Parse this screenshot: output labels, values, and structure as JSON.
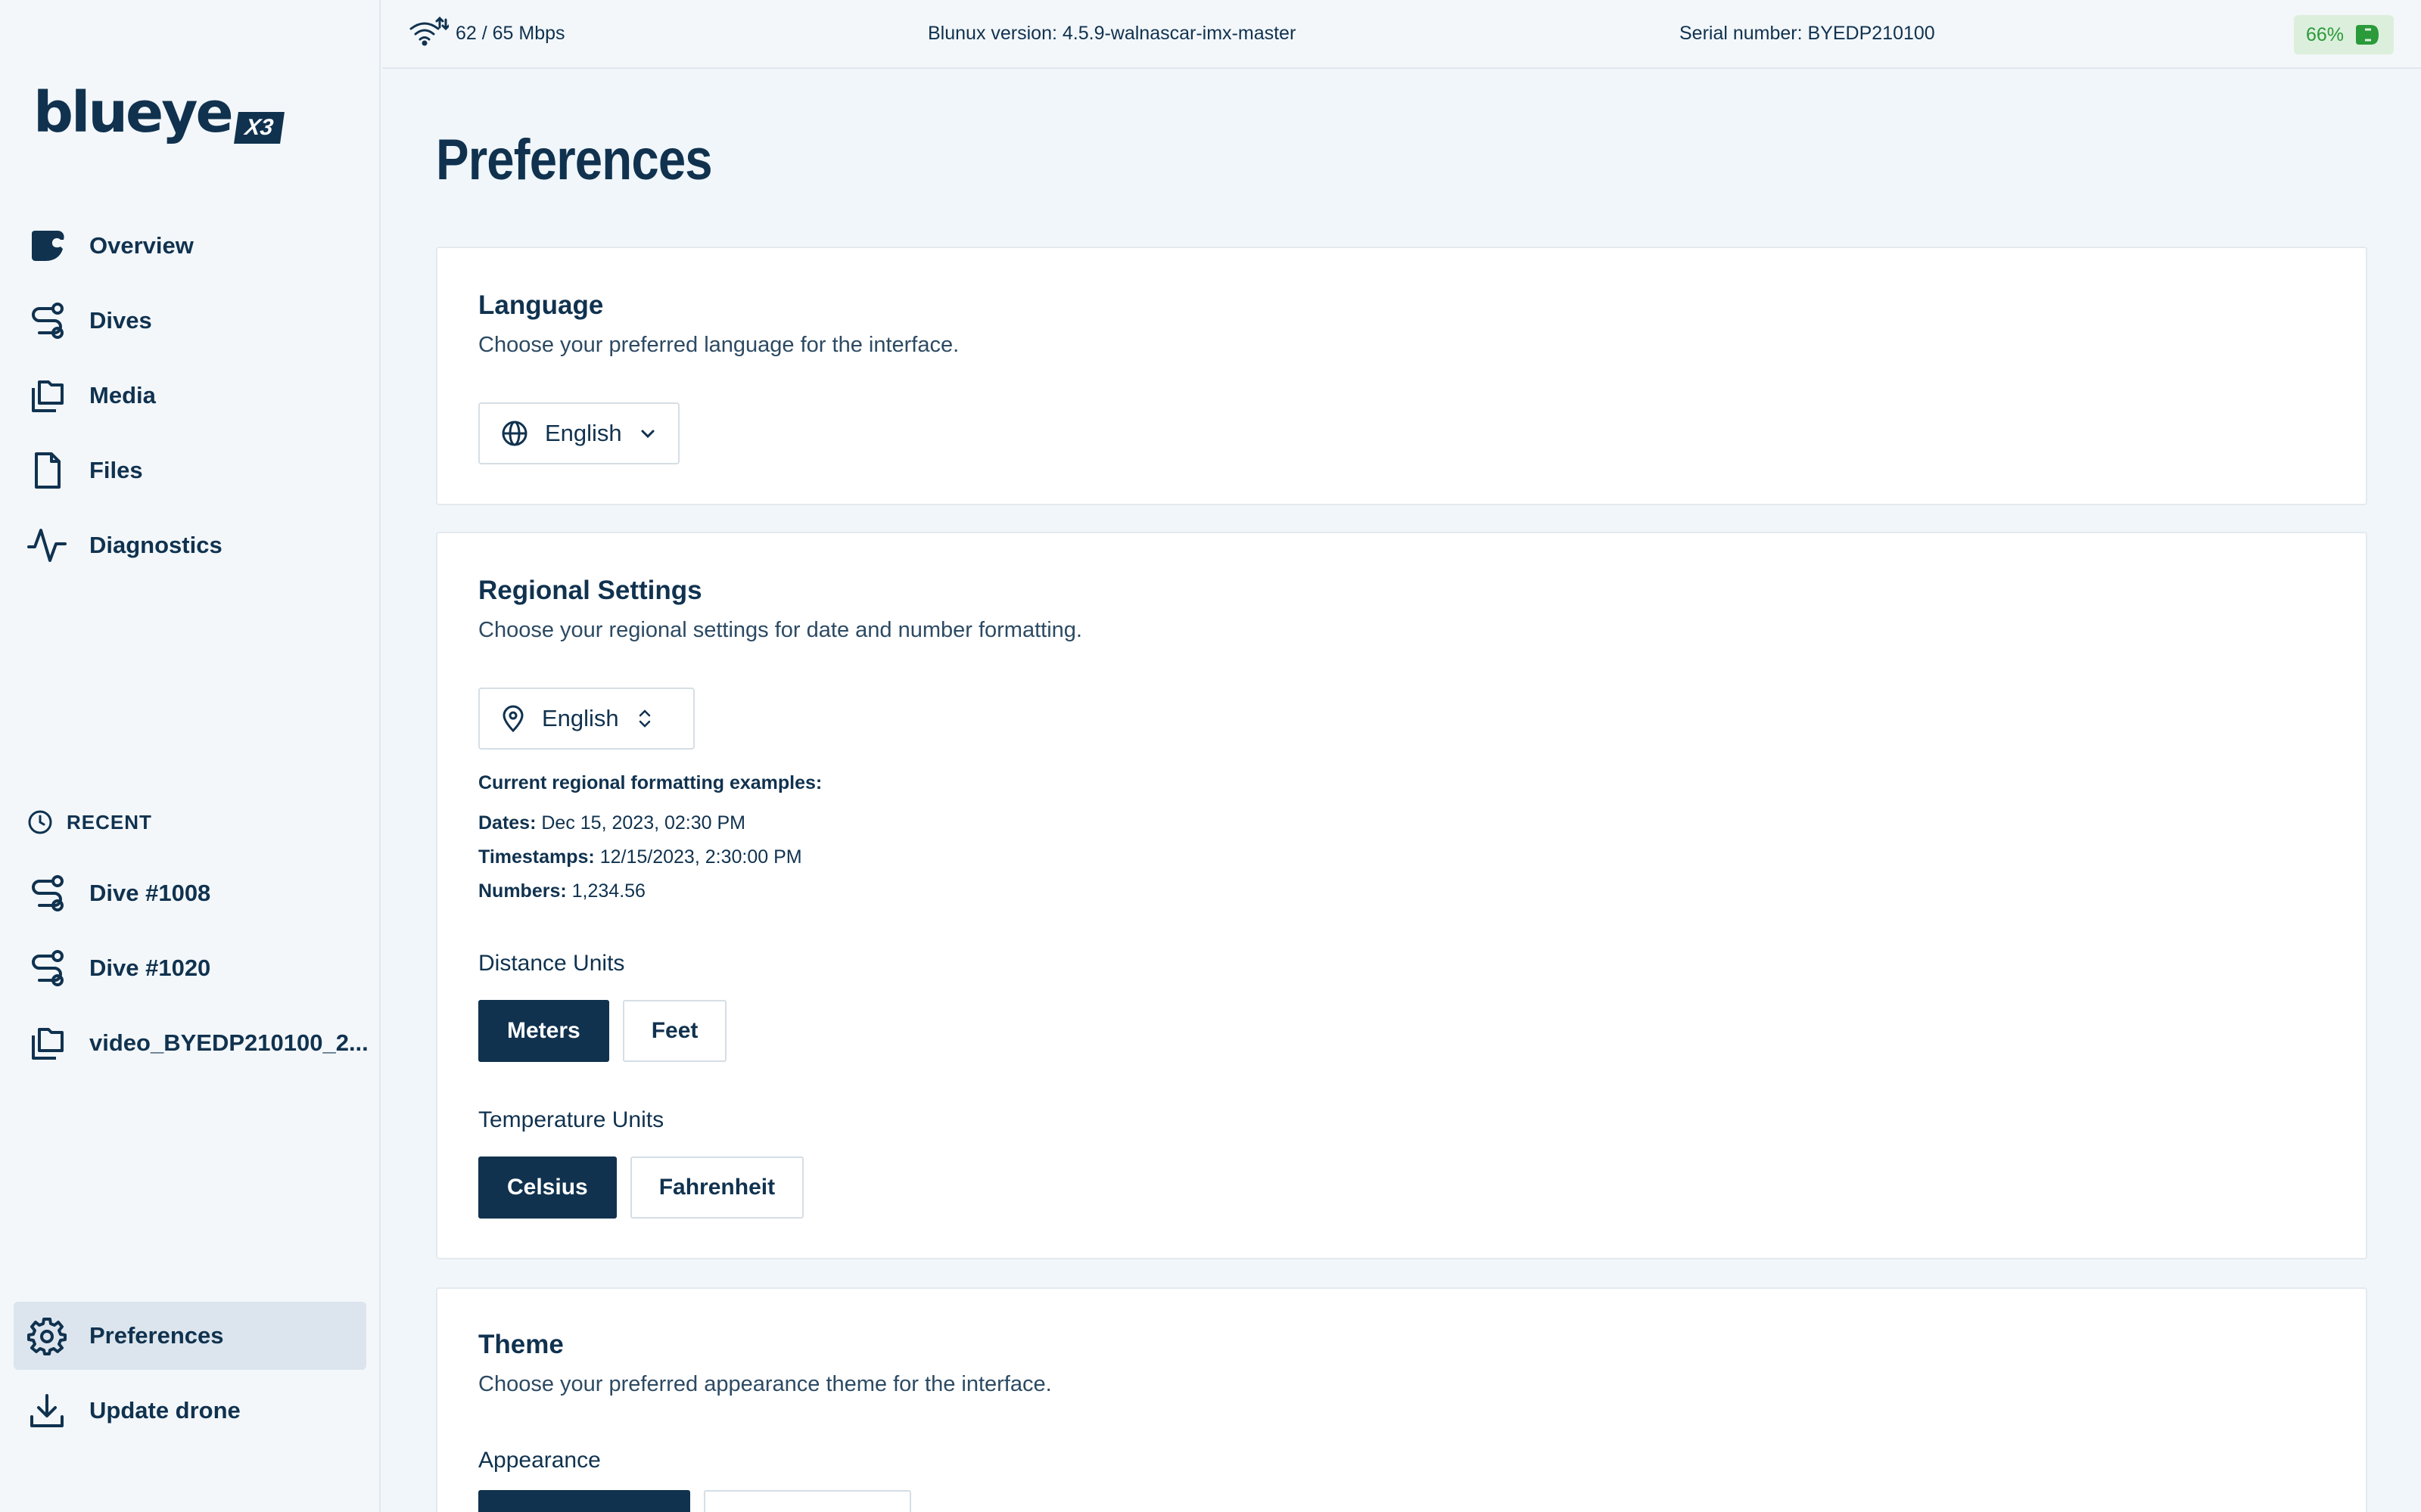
{
  "brand": {
    "wordmark": "blueye",
    "model": "X3"
  },
  "sidebar": {
    "nav": [
      {
        "label": "Overview",
        "icon": "overview-icon"
      },
      {
        "label": "Dives",
        "icon": "dives-icon"
      },
      {
        "label": "Media",
        "icon": "media-icon"
      },
      {
        "label": "Files",
        "icon": "file-icon"
      },
      {
        "label": "Diagnostics",
        "icon": "activity-icon"
      }
    ],
    "recent_heading": "RECENT",
    "recent": [
      {
        "label": "Dive #1008",
        "icon": "dives-icon"
      },
      {
        "label": "Dive #1020",
        "icon": "dives-icon"
      },
      {
        "label": "video_BYEDP210100_2...",
        "icon": "media-icon"
      }
    ],
    "bottom": [
      {
        "label": "Preferences",
        "icon": "gear-icon",
        "active": true
      },
      {
        "label": "Update drone",
        "icon": "download-icon"
      }
    ]
  },
  "topbar": {
    "network": "62 / 65 Mbps",
    "version": "Blunux version: 4.5.9-walnascar-imx-master",
    "serial": "Serial number: BYEDP210100",
    "battery": "66%"
  },
  "page": {
    "title": "Preferences",
    "language": {
      "title": "Language",
      "description": "Choose your preferred language for the interface.",
      "selected": "English"
    },
    "regional": {
      "title": "Regional Settings",
      "description": "Choose your regional settings for date and number formatting.",
      "selected": "English",
      "examples_heading": "Current regional formatting examples:",
      "examples": [
        {
          "label": "Dates:",
          "value": "Dec 15, 2023, 02:30 PM"
        },
        {
          "label": "Timestamps:",
          "value": "12/15/2023, 2:30:00 PM"
        },
        {
          "label": "Numbers:",
          "value": "1,234.56"
        }
      ],
      "distance_label": "Distance Units",
      "distance_options": [
        "Meters",
        "Feet"
      ],
      "temperature_label": "Temperature Units",
      "temperature_options": [
        "Celsius",
        "Fahrenheit"
      ]
    },
    "theme": {
      "title": "Theme",
      "description": "Choose your preferred appearance theme for the interface.",
      "appearance_label": "Appearance"
    }
  },
  "colors": {
    "primary": "#10324f",
    "background": "#f1f6fa",
    "battery": "#2a9a3a"
  }
}
